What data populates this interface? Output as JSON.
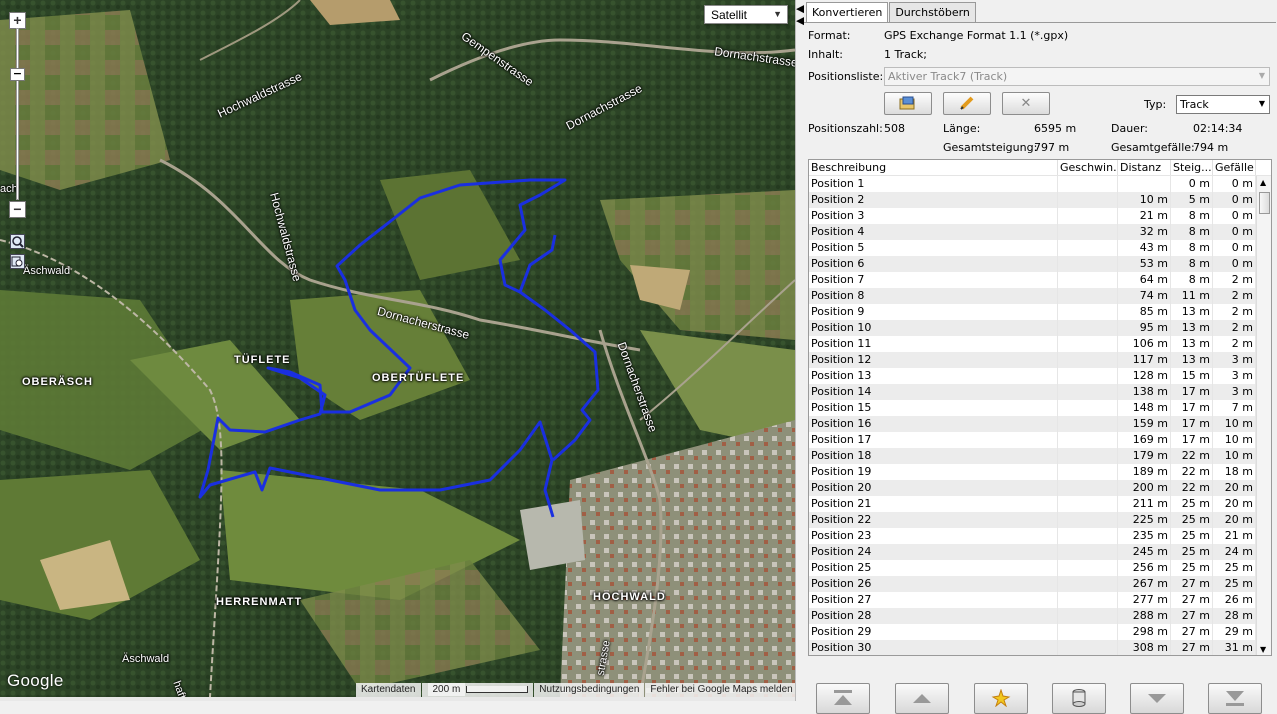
{
  "map": {
    "map_type": "Satellit",
    "zoom_in": "+",
    "zoom_out": "−",
    "zoom_mid": "−",
    "google_logo": "Google",
    "footer": {
      "attribution": "Kartendaten",
      "scale": "200 m",
      "terms": "Nutzungsbedingungen",
      "report": "Fehler bei Google Maps melden"
    },
    "labels": {
      "hochwaldstrasse_1": "Hochwaldstrasse",
      "hochwaldstrasse_2": "Hochwaldstrasse",
      "dornachstrasse_top": "Dornachstrasse",
      "dornachstrasse_mid": "Dornachstrasse",
      "gempenstrasse": "Gempenstrasse",
      "dornacherstrasse": "Dornacherstrasse",
      "dornacherstrasse_v": "Dornacherstrasse",
      "tueflete": "TÜFLETE",
      "obertueflete": "OBERTÜFLETE",
      "oberaesch": "OBERÄSCH",
      "aeschwald_1": "Äschwald",
      "aeschwald_2": "Äschwald",
      "herrenmatt": "HERRENMATT",
      "hochwald": "HOCHWALD",
      "left_edge": "ach",
      "bottom_street_1": "haft",
      "bottom_street_2": "strasse"
    },
    "track_color": "#1a2fe0"
  },
  "panel": {
    "tabs": [
      "Konvertieren",
      "Durchstöbern"
    ],
    "format_label": "Format:",
    "format_value": "GPS Exchange Format 1.1 (*.gpx)",
    "inhalt_label": "Inhalt:",
    "inhalt_value": "1 Track;",
    "positionsliste_label": "Positionsliste:",
    "positionsliste_value": "Aktiver Track7 (Track)",
    "typ_label": "Typ:",
    "typ_value": "Track",
    "stats": {
      "positionszahl_label": "Positionszahl:",
      "positionszahl_value": "508",
      "laenge_label": "Länge:",
      "laenge_value": "6595 m",
      "dauer_label": "Dauer:",
      "dauer_value": "02:14:34",
      "steigung_label": "Gesamtsteigung:",
      "steigung_value": "797 m",
      "gefaelle_label": "Gesamtgefälle:",
      "gefaelle_value": "794 m"
    },
    "table": {
      "headers": [
        "Beschreibung",
        "Geschwin...",
        "Distanz",
        "Steig...",
        "Gefälle"
      ],
      "rows": [
        [
          "Position 1",
          "",
          "",
          "0 m",
          "0 m"
        ],
        [
          "Position 2",
          "",
          "10 m",
          "5 m",
          "0 m"
        ],
        [
          "Position 3",
          "",
          "21 m",
          "8 m",
          "0 m"
        ],
        [
          "Position 4",
          "",
          "32 m",
          "8 m",
          "0 m"
        ],
        [
          "Position 5",
          "",
          "43 m",
          "8 m",
          "0 m"
        ],
        [
          "Position 6",
          "",
          "53 m",
          "8 m",
          "0 m"
        ],
        [
          "Position 7",
          "",
          "64 m",
          "8 m",
          "2 m"
        ],
        [
          "Position 8",
          "",
          "74 m",
          "11 m",
          "2 m"
        ],
        [
          "Position 9",
          "",
          "85 m",
          "13 m",
          "2 m"
        ],
        [
          "Position 10",
          "",
          "95 m",
          "13 m",
          "2 m"
        ],
        [
          "Position 11",
          "",
          "106 m",
          "13 m",
          "2 m"
        ],
        [
          "Position 12",
          "",
          "117 m",
          "13 m",
          "3 m"
        ],
        [
          "Position 13",
          "",
          "128 m",
          "15 m",
          "3 m"
        ],
        [
          "Position 14",
          "",
          "138 m",
          "17 m",
          "3 m"
        ],
        [
          "Position 15",
          "",
          "148 m",
          "17 m",
          "7 m"
        ],
        [
          "Position 16",
          "",
          "159 m",
          "17 m",
          "10 m"
        ],
        [
          "Position 17",
          "",
          "169 m",
          "17 m",
          "10 m"
        ],
        [
          "Position 18",
          "",
          "179 m",
          "22 m",
          "10 m"
        ],
        [
          "Position 19",
          "",
          "189 m",
          "22 m",
          "18 m"
        ],
        [
          "Position 20",
          "",
          "200 m",
          "22 m",
          "20 m"
        ],
        [
          "Position 21",
          "",
          "211 m",
          "25 m",
          "20 m"
        ],
        [
          "Position 22",
          "",
          "225 m",
          "25 m",
          "20 m"
        ],
        [
          "Position 23",
          "",
          "235 m",
          "25 m",
          "21 m"
        ],
        [
          "Position 24",
          "",
          "245 m",
          "25 m",
          "24 m"
        ],
        [
          "Position 25",
          "",
          "256 m",
          "25 m",
          "25 m"
        ],
        [
          "Position 26",
          "",
          "267 m",
          "27 m",
          "25 m"
        ],
        [
          "Position 27",
          "",
          "277 m",
          "27 m",
          "26 m"
        ],
        [
          "Position 28",
          "",
          "288 m",
          "27 m",
          "28 m"
        ],
        [
          "Position 29",
          "",
          "298 m",
          "27 m",
          "29 m"
        ],
        [
          "Position 30",
          "",
          "308 m",
          "27 m",
          "31 m"
        ]
      ]
    },
    "tool_buttons": [
      "import-icon",
      "pencil-icon",
      "close-icon"
    ],
    "nav_buttons": [
      "first-icon",
      "up-icon",
      "star-icon",
      "database-icon",
      "down-icon",
      "last-icon"
    ]
  }
}
